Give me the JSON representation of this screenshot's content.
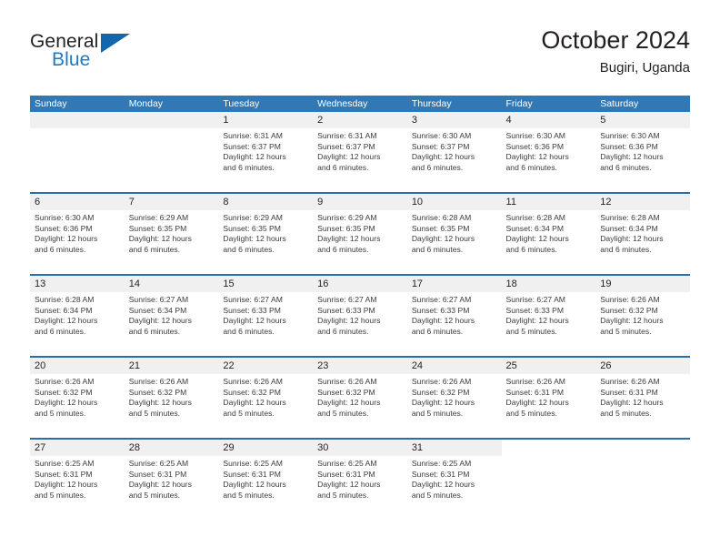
{
  "brand": {
    "name_part1": "General",
    "name_part2": "Blue",
    "flag_icon": "triangle-flag-icon"
  },
  "header": {
    "title": "October 2024",
    "location": "Bugiri, Uganda"
  },
  "colors": {
    "header_blue": "#3178b5",
    "row_divider_blue": "#2b6cab",
    "date_band_gray": "#f0f0f0",
    "brand_blue": "#1f7ac4",
    "text": "#231f20"
  },
  "weekdays": [
    "Sunday",
    "Monday",
    "Tuesday",
    "Wednesday",
    "Thursday",
    "Friday",
    "Saturday"
  ],
  "weeks": [
    [
      {
        "day": "",
        "lines": []
      },
      {
        "day": "",
        "lines": []
      },
      {
        "day": "1",
        "lines": [
          "Sunrise: 6:31 AM",
          "Sunset: 6:37 PM",
          "Daylight: 12 hours",
          "and 6 minutes."
        ]
      },
      {
        "day": "2",
        "lines": [
          "Sunrise: 6:31 AM",
          "Sunset: 6:37 PM",
          "Daylight: 12 hours",
          "and 6 minutes."
        ]
      },
      {
        "day": "3",
        "lines": [
          "Sunrise: 6:30 AM",
          "Sunset: 6:37 PM",
          "Daylight: 12 hours",
          "and 6 minutes."
        ]
      },
      {
        "day": "4",
        "lines": [
          "Sunrise: 6:30 AM",
          "Sunset: 6:36 PM",
          "Daylight: 12 hours",
          "and 6 minutes."
        ]
      },
      {
        "day": "5",
        "lines": [
          "Sunrise: 6:30 AM",
          "Sunset: 6:36 PM",
          "Daylight: 12 hours",
          "and 6 minutes."
        ]
      }
    ],
    [
      {
        "day": "6",
        "lines": [
          "Sunrise: 6:30 AM",
          "Sunset: 6:36 PM",
          "Daylight: 12 hours",
          "and 6 minutes."
        ]
      },
      {
        "day": "7",
        "lines": [
          "Sunrise: 6:29 AM",
          "Sunset: 6:35 PM",
          "Daylight: 12 hours",
          "and 6 minutes."
        ]
      },
      {
        "day": "8",
        "lines": [
          "Sunrise: 6:29 AM",
          "Sunset: 6:35 PM",
          "Daylight: 12 hours",
          "and 6 minutes."
        ]
      },
      {
        "day": "9",
        "lines": [
          "Sunrise: 6:29 AM",
          "Sunset: 6:35 PM",
          "Daylight: 12 hours",
          "and 6 minutes."
        ]
      },
      {
        "day": "10",
        "lines": [
          "Sunrise: 6:28 AM",
          "Sunset: 6:35 PM",
          "Daylight: 12 hours",
          "and 6 minutes."
        ]
      },
      {
        "day": "11",
        "lines": [
          "Sunrise: 6:28 AM",
          "Sunset: 6:34 PM",
          "Daylight: 12 hours",
          "and 6 minutes."
        ]
      },
      {
        "day": "12",
        "lines": [
          "Sunrise: 6:28 AM",
          "Sunset: 6:34 PM",
          "Daylight: 12 hours",
          "and 6 minutes."
        ]
      }
    ],
    [
      {
        "day": "13",
        "lines": [
          "Sunrise: 6:28 AM",
          "Sunset: 6:34 PM",
          "Daylight: 12 hours",
          "and 6 minutes."
        ]
      },
      {
        "day": "14",
        "lines": [
          "Sunrise: 6:27 AM",
          "Sunset: 6:34 PM",
          "Daylight: 12 hours",
          "and 6 minutes."
        ]
      },
      {
        "day": "15",
        "lines": [
          "Sunrise: 6:27 AM",
          "Sunset: 6:33 PM",
          "Daylight: 12 hours",
          "and 6 minutes."
        ]
      },
      {
        "day": "16",
        "lines": [
          "Sunrise: 6:27 AM",
          "Sunset: 6:33 PM",
          "Daylight: 12 hours",
          "and 6 minutes."
        ]
      },
      {
        "day": "17",
        "lines": [
          "Sunrise: 6:27 AM",
          "Sunset: 6:33 PM",
          "Daylight: 12 hours",
          "and 6 minutes."
        ]
      },
      {
        "day": "18",
        "lines": [
          "Sunrise: 6:27 AM",
          "Sunset: 6:33 PM",
          "Daylight: 12 hours",
          "and 5 minutes."
        ]
      },
      {
        "day": "19",
        "lines": [
          "Sunrise: 6:26 AM",
          "Sunset: 6:32 PM",
          "Daylight: 12 hours",
          "and 5 minutes."
        ]
      }
    ],
    [
      {
        "day": "20",
        "lines": [
          "Sunrise: 6:26 AM",
          "Sunset: 6:32 PM",
          "Daylight: 12 hours",
          "and 5 minutes."
        ]
      },
      {
        "day": "21",
        "lines": [
          "Sunrise: 6:26 AM",
          "Sunset: 6:32 PM",
          "Daylight: 12 hours",
          "and 5 minutes."
        ]
      },
      {
        "day": "22",
        "lines": [
          "Sunrise: 6:26 AM",
          "Sunset: 6:32 PM",
          "Daylight: 12 hours",
          "and 5 minutes."
        ]
      },
      {
        "day": "23",
        "lines": [
          "Sunrise: 6:26 AM",
          "Sunset: 6:32 PM",
          "Daylight: 12 hours",
          "and 5 minutes."
        ]
      },
      {
        "day": "24",
        "lines": [
          "Sunrise: 6:26 AM",
          "Sunset: 6:32 PM",
          "Daylight: 12 hours",
          "and 5 minutes."
        ]
      },
      {
        "day": "25",
        "lines": [
          "Sunrise: 6:26 AM",
          "Sunset: 6:31 PM",
          "Daylight: 12 hours",
          "and 5 minutes."
        ]
      },
      {
        "day": "26",
        "lines": [
          "Sunrise: 6:26 AM",
          "Sunset: 6:31 PM",
          "Daylight: 12 hours",
          "and 5 minutes."
        ]
      }
    ],
    [
      {
        "day": "27",
        "lines": [
          "Sunrise: 6:25 AM",
          "Sunset: 6:31 PM",
          "Daylight: 12 hours",
          "and 5 minutes."
        ]
      },
      {
        "day": "28",
        "lines": [
          "Sunrise: 6:25 AM",
          "Sunset: 6:31 PM",
          "Daylight: 12 hours",
          "and 5 minutes."
        ]
      },
      {
        "day": "29",
        "lines": [
          "Sunrise: 6:25 AM",
          "Sunset: 6:31 PM",
          "Daylight: 12 hours",
          "and 5 minutes."
        ]
      },
      {
        "day": "30",
        "lines": [
          "Sunrise: 6:25 AM",
          "Sunset: 6:31 PM",
          "Daylight: 12 hours",
          "and 5 minutes."
        ]
      },
      {
        "day": "31",
        "lines": [
          "Sunrise: 6:25 AM",
          "Sunset: 6:31 PM",
          "Daylight: 12 hours",
          "and 5 minutes."
        ]
      },
      {
        "day": "",
        "lines": []
      },
      {
        "day": "",
        "lines": []
      }
    ]
  ]
}
